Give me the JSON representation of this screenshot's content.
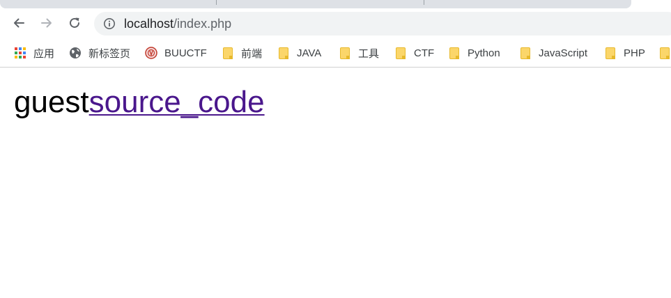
{
  "browser": {
    "url_host": "localhost",
    "url_path": "/index.php"
  },
  "bookmarks": [
    {
      "label": "应用",
      "icon": "apps-grid-icon"
    },
    {
      "label": "新标签页",
      "icon": "globe-icon"
    },
    {
      "label": "BUUCTF",
      "icon": "buuctf-logo-icon"
    },
    {
      "label": "前端",
      "icon": "folder-icon"
    },
    {
      "label": "JAVA",
      "icon": "folder-icon"
    },
    {
      "label": "工具",
      "icon": "folder-icon"
    },
    {
      "label": "CTF",
      "icon": "folder-icon"
    },
    {
      "label": "Python",
      "icon": "folder-icon"
    },
    {
      "label": "JavaScript",
      "icon": "folder-icon"
    },
    {
      "label": "PHP",
      "icon": "folder-icon"
    }
  ],
  "page": {
    "text": "guest",
    "link_text": "source_code"
  },
  "colors": {
    "link_visited": "#4a178c",
    "folder": "#fbd66a",
    "omnibox_bg": "#f1f3f4"
  }
}
